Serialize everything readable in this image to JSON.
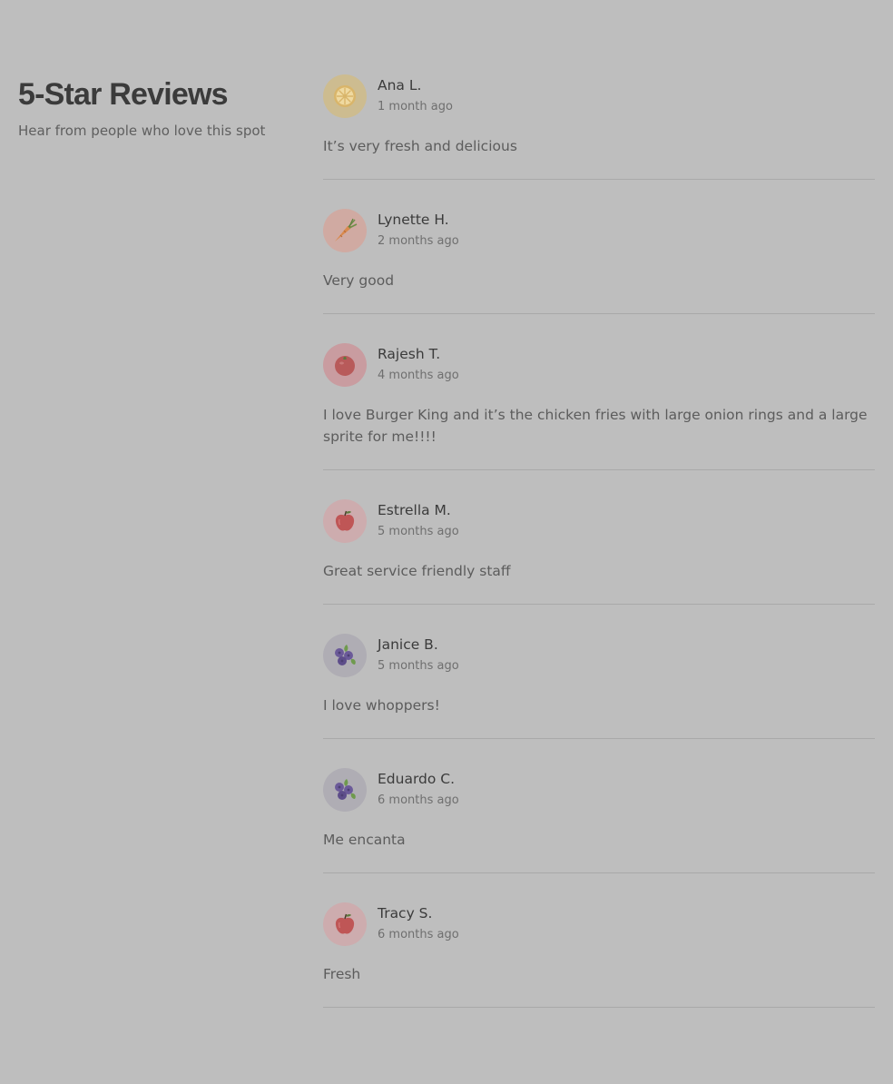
{
  "section": {
    "title": "5-Star Reviews",
    "subtitle": "Hear from people who love this spot"
  },
  "reviews": [
    {
      "name": "Ana L.",
      "time": "1 month ago",
      "text": "It’s very fresh and delicious",
      "avatar_icon": "lemon-icon",
      "avatar_bg": "#cdbc90"
    },
    {
      "name": "Lynette H.",
      "time": "2 months ago",
      "text": "Very good",
      "avatar_icon": "carrot-icon",
      "avatar_bg": "#d0aaa2"
    },
    {
      "name": "Rajesh T.",
      "time": "4 months ago",
      "text": "I love Burger King and it’s the chicken fries with large onion rings and a large sprite for me!!!!",
      "avatar_icon": "tomato-icon",
      "avatar_bg": "#c99ca0"
    },
    {
      "name": "Estrella M.",
      "time": "5 months ago",
      "text": "Great service friendly staff",
      "avatar_icon": "apple-icon",
      "avatar_bg": "#cdacae"
    },
    {
      "name": "Janice B.",
      "time": "5 months ago",
      "text": "I love whoppers!",
      "avatar_icon": "blueberry-icon",
      "avatar_bg": "#afadb4"
    },
    {
      "name": "Eduardo C.",
      "time": "6 months ago",
      "text": "Me encanta",
      "avatar_icon": "blueberry-icon",
      "avatar_bg": "#afadb4"
    },
    {
      "name": "Tracy S.",
      "time": "6 months ago",
      "text": "Fresh",
      "avatar_icon": "apple-icon",
      "avatar_bg": "#cdacae"
    }
  ]
}
